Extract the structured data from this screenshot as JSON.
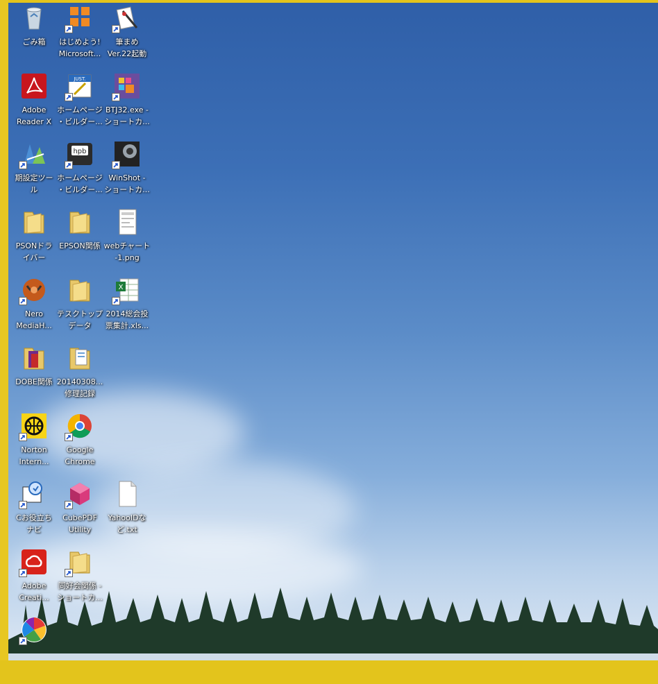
{
  "desktop": {
    "icons": [
      {
        "label": "ごみ箱",
        "icon": "recycle-bin-icon",
        "shortcut": false
      },
      {
        "label": "はじめよう!\nMicrosoft...",
        "icon": "office-icon",
        "shortcut": true
      },
      {
        "label": "筆まめ\nVer.22起動",
        "icon": "fudemame-icon",
        "shortcut": true
      },
      {
        "label": "Adobe\nReader X",
        "icon": "adobe-reader-icon",
        "shortcut": false
      },
      {
        "label": "ホームページ\n・ビルダー...",
        "icon": "just-homepage-builder-icon",
        "shortcut": true
      },
      {
        "label": "BTJ32.exe -\nショートカ...",
        "icon": "btj32-icon",
        "shortcut": true
      },
      {
        "label": "期設定ツー\nル",
        "icon": "setup-tool-icon",
        "shortcut": true
      },
      {
        "label": "ホームページ\n・ビルダー...",
        "icon": "hpb-icon",
        "shortcut": true
      },
      {
        "label": "WinShot -\nショートカ...",
        "icon": "winshot-icon",
        "shortcut": true
      },
      {
        "label": "PSONドラ\nイバー",
        "icon": "folder-icon",
        "shortcut": false
      },
      {
        "label": "EPSON関係",
        "icon": "folder-icon",
        "shortcut": false
      },
      {
        "label": "webチャート\n-1.png",
        "icon": "image-file-icon",
        "shortcut": false
      },
      {
        "label": "Nero\nMediaH...",
        "icon": "nero-icon",
        "shortcut": true
      },
      {
        "label": "テスクトップ\nデータ",
        "icon": "folder-icon",
        "shortcut": false
      },
      {
        "label": "2014総会投\n票集計.xls...",
        "icon": "excel-icon",
        "shortcut": true
      },
      {
        "label": "DOBE関係",
        "icon": "adobe-folder-icon",
        "shortcut": false
      },
      {
        "label": "20140308...\n修理記録",
        "icon": "document-folder-icon",
        "shortcut": false
      },
      {
        "label": "Norton\nIntern...",
        "icon": "norton-icon",
        "shortcut": true
      },
      {
        "label": "Google\nChrome",
        "icon": "chrome-icon",
        "shortcut": true
      },
      {
        "label": "Cお役立ち\nナビ",
        "icon": "navi-icon",
        "shortcut": true
      },
      {
        "label": "CubePDF\nUtility",
        "icon": "cubepdf-icon",
        "shortcut": true
      },
      {
        "label": "YahooIDな\nど.txt",
        "icon": "text-file-icon",
        "shortcut": false
      },
      {
        "label": "Adobe\nCreati...",
        "icon": "creative-cloud-icon",
        "shortcut": true
      },
      {
        "label": "同好会関係 -\nショートカ...",
        "icon": "folder-icon",
        "shortcut": true
      },
      {
        "label": "",
        "icon": "picasa-icon",
        "shortcut": true
      }
    ]
  }
}
